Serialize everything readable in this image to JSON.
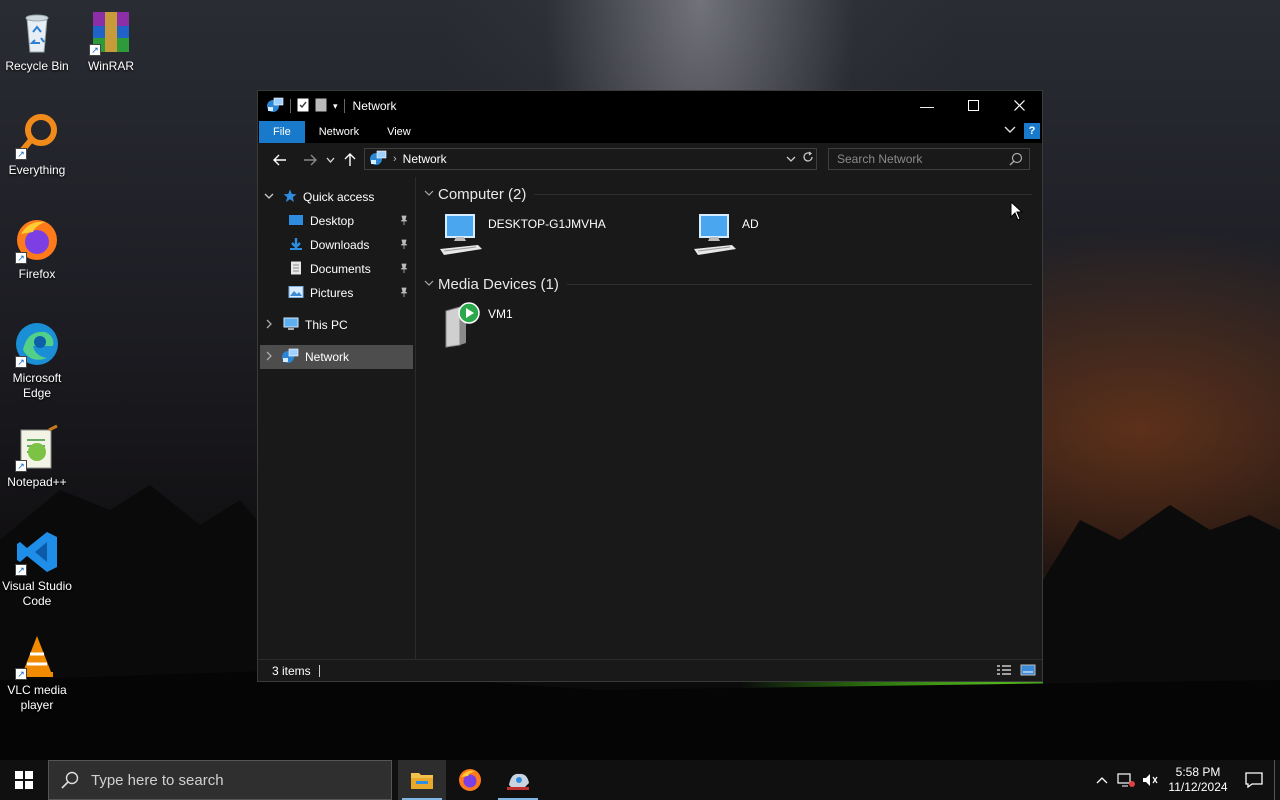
{
  "desktop": {
    "icons": [
      {
        "label": "Recycle Bin",
        "icon": "recycle-bin-icon"
      },
      {
        "label": "WinRAR",
        "icon": "winrar-icon"
      },
      {
        "label": "Everything",
        "icon": "everything-search-icon"
      },
      {
        "label": "Firefox",
        "icon": "firefox-icon"
      },
      {
        "label": "Microsoft Edge",
        "icon": "edge-icon"
      },
      {
        "label": "Notepad++",
        "icon": "notepadpp-icon"
      },
      {
        "label": "Visual Studio Code",
        "icon": "vscode-icon"
      },
      {
        "label": "VLC media player",
        "icon": "vlc-icon"
      }
    ]
  },
  "window": {
    "title": "Network",
    "ribbon": {
      "tabs": [
        "File",
        "Network",
        "View"
      ],
      "help": "?"
    },
    "address": {
      "crumbs": [
        "Network"
      ]
    },
    "search": {
      "placeholder": "Search Network"
    },
    "navpane": {
      "quick_access": "Quick access",
      "pinned": [
        "Desktop",
        "Downloads",
        "Documents",
        "Pictures"
      ],
      "this_pc": "This PC",
      "network": "Network"
    },
    "groups": [
      {
        "header": "Computer (2)",
        "items": [
          "DESKTOP-G1JMVHA",
          "AD"
        ]
      },
      {
        "header": "Media Devices (1)",
        "items": [
          "VM1"
        ]
      }
    ],
    "status": {
      "count": "3 items"
    }
  },
  "taskbar": {
    "search_placeholder": "Type here to search",
    "time": "5:58 PM",
    "date": "11/12/2024"
  },
  "colors": {
    "accent": "#1979ca",
    "window_bg": "#191919",
    "selected": "#4d4d4d"
  }
}
